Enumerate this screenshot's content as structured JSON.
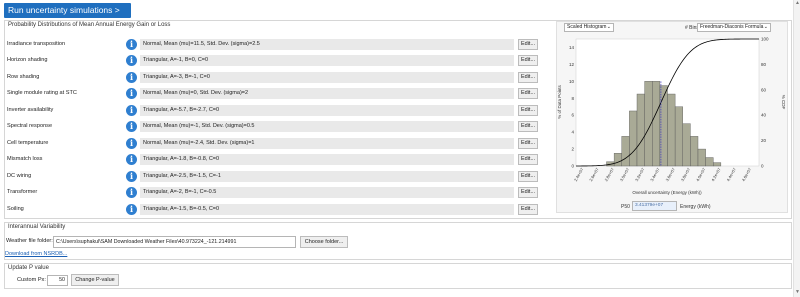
{
  "run_button": {
    "label": "Run uncertainty simulations >"
  },
  "distributions": {
    "title": "Probability Distributions of Mean Annual Energy Gain or Loss",
    "edit_label": "Edit...",
    "items": [
      {
        "label": "Irradiance transposition",
        "dist": "Normal, Mean (mu)=11.5, Std. Dev. (sigma)=2.5"
      },
      {
        "label": "Horizon shading",
        "dist": "Triangular, A=-1, B=0, C=0"
      },
      {
        "label": "Row shading",
        "dist": "Triangular, A=-3, B=-1, C=0"
      },
      {
        "label": "Single module rating at STC",
        "dist": "Normal, Mean (mu)=0, Std. Dev. (sigma)=2"
      },
      {
        "label": "Inverter availability",
        "dist": "Triangular, A=-5.7, B=-2.7, C=0"
      },
      {
        "label": "Spectral response",
        "dist": "Normal, Mean (mu)=-1, Std. Dev. (sigma)=0.5"
      },
      {
        "label": "Cell temperature",
        "dist": "Normal, Mean (mu)=-2.4, Std. Dev. (sigma)=1"
      },
      {
        "label": "Mismatch loss",
        "dist": "Triangular, A=-1.8, B=-0.8, C=0"
      },
      {
        "label": "DC wiring",
        "dist": "Triangular, A=-2.5, B=-1.5, C=-1"
      },
      {
        "label": "Transformer",
        "dist": "Triangular, A=-2, B=-1, C=-0.5"
      },
      {
        "label": "Soiling",
        "dist": "Triangular, A=-1.5, B=-0.5, C=0"
      }
    ]
  },
  "plot_panel": {
    "view_select": "Scaled Histogram",
    "bins_label": "# Bins:",
    "bins_select": "Freedman-Diaconis Formula",
    "p50_label": "P50",
    "p50_value": "3.41379e+07",
    "p50_unit": "Energy (kWh)"
  },
  "chart_data": {
    "type": "bar",
    "xlabel": "Overall uncertainty (Energy (kWh))",
    "ylabel_left": "% of Data Points",
    "ylabel_right": "% CDF",
    "ylim": [
      0,
      15
    ],
    "ylim_right": [
      0,
      100
    ],
    "left_ticks": [
      "0",
      "2",
      "4",
      "6",
      "8",
      "10",
      "12",
      "14"
    ],
    "right_ticks": [
      "0",
      "20",
      "40",
      "60",
      "80",
      "100"
    ],
    "x_tick_labels": [
      "2.4e+07",
      "2.6e+07",
      "2.8e+07",
      "3.0e+07",
      "3.2e+07",
      "3.4e+07",
      "3.6e+07",
      "3.8e+07",
      "4.0e+07",
      "4.2e+07",
      "4.4e+07",
      "4.6e+07"
    ],
    "x_range": [
      23000000,
      47000000
    ],
    "bin_width": 1000000,
    "bin_starts": [
      27000000,
      28000000,
      29000000,
      30000000,
      31000000,
      32000000,
      33000000,
      34000000,
      35000000,
      36000000,
      37000000,
      38000000,
      39000000,
      40000000,
      41000000
    ],
    "values": [
      0.5,
      1.5,
      3.5,
      6.5,
      8.5,
      10.0,
      10.0,
      9.5,
      8.5,
      7.0,
      5.0,
      3.5,
      2.0,
      1.0,
      0.4
    ],
    "p50": 34137900,
    "cdf_mean": 34137900,
    "cdf_std": 3000000,
    "bar_color": "#a9aa96",
    "p50_line_color": "#3a35c7"
  },
  "interannual": {
    "title": "Interannual Variability",
    "weather_label": "Weather file folder:",
    "weather_value": "C:\\Users\\suphakul\\SAM Downloaded Weather Files\\40.973224_-121.214991",
    "choose_label": "Choose folder...",
    "download_link": "Download from NSRDB..."
  },
  "pvalue": {
    "title": "Update P value",
    "custom_label": "Custom Px:",
    "custom_value": "50",
    "change_label": "Change P-value"
  }
}
